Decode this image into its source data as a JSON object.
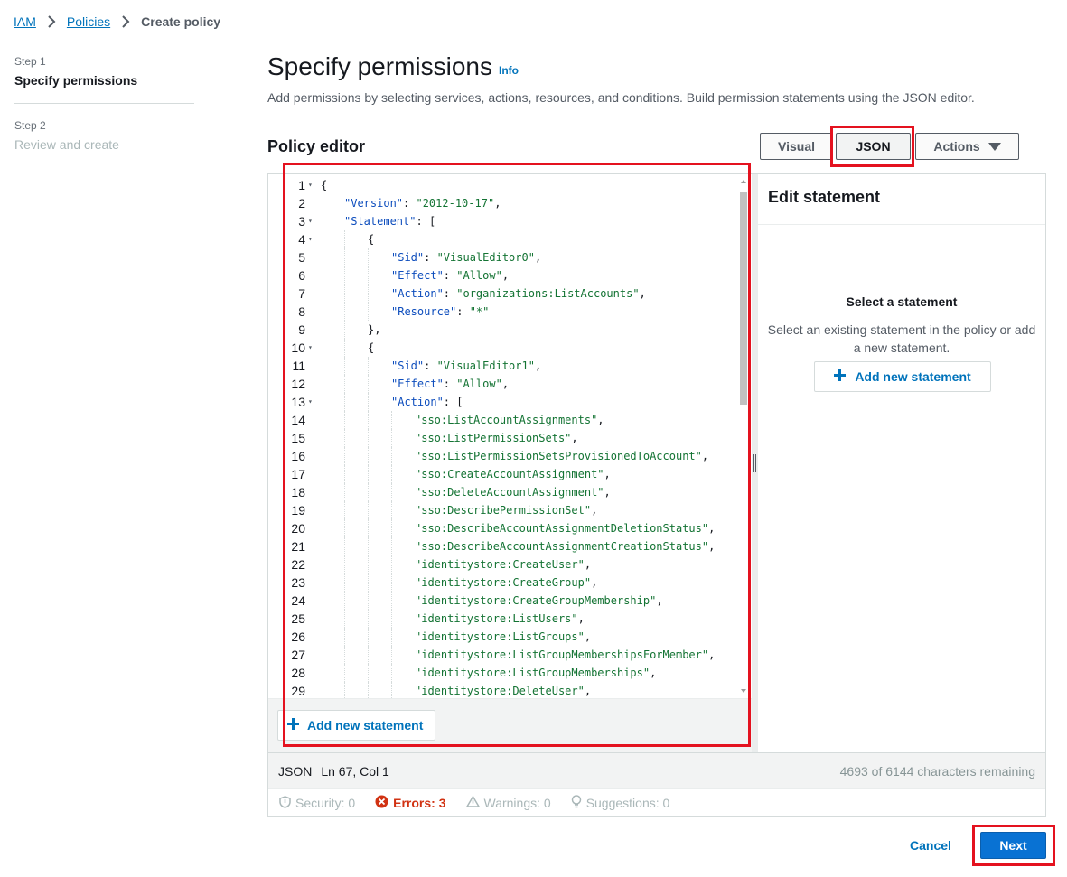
{
  "breadcrumb": {
    "items": [
      "IAM",
      "Policies"
    ],
    "current": "Create policy"
  },
  "steps": [
    {
      "num": "Step 1",
      "title": "Specify permissions"
    },
    {
      "num": "Step 2",
      "title": "Review and create"
    }
  ],
  "header": {
    "title": "Specify permissions",
    "info": "Info",
    "description": "Add permissions by selecting services, actions, resources, and conditions. Build permission statements using the JSON editor."
  },
  "editor": {
    "title": "Policy editor",
    "modes": {
      "visual": "Visual",
      "json": "JSON",
      "actions": "Actions"
    },
    "add_statement": "Add new statement",
    "status": {
      "mode": "JSON",
      "position": "Ln 67, Col 1",
      "remaining": "4693 of 6144 characters remaining"
    },
    "issues": {
      "security": "Security: 0",
      "errors": "Errors: 3",
      "warnings": "Warnings: 0",
      "suggestions": "Suggestions: 0"
    }
  },
  "code": [
    {
      "n": "1",
      "fold": true,
      "indent": 0,
      "text": "{"
    },
    {
      "n": "2",
      "fold": false,
      "indent": 1,
      "key": "\"Version\"",
      "val": "\"2012-10-17\"",
      "tail": ","
    },
    {
      "n": "3",
      "fold": true,
      "indent": 1,
      "key": "\"Statement\"",
      "tail": " ["
    },
    {
      "n": "4",
      "fold": true,
      "indent": 2,
      "text": "{"
    },
    {
      "n": "5",
      "fold": false,
      "indent": 3,
      "key": "\"Sid\"",
      "val": "\"VisualEditor0\"",
      "tail": ","
    },
    {
      "n": "6",
      "fold": false,
      "indent": 3,
      "key": "\"Effect\"",
      "val": "\"Allow\"",
      "tail": ","
    },
    {
      "n": "7",
      "fold": false,
      "indent": 3,
      "key": "\"Action\"",
      "val": "\"organizations:ListAccounts\"",
      "tail": ","
    },
    {
      "n": "8",
      "fold": false,
      "indent": 3,
      "key": "\"Resource\"",
      "val": "\"*\"",
      "tail": ""
    },
    {
      "n": "9",
      "fold": false,
      "indent": 2,
      "text": "},"
    },
    {
      "n": "10",
      "fold": true,
      "indent": 2,
      "text": "{"
    },
    {
      "n": "11",
      "fold": false,
      "indent": 3,
      "key": "\"Sid\"",
      "val": "\"VisualEditor1\"",
      "tail": ","
    },
    {
      "n": "12",
      "fold": false,
      "indent": 3,
      "key": "\"Effect\"",
      "val": "\"Allow\"",
      "tail": ","
    },
    {
      "n": "13",
      "fold": true,
      "indent": 3,
      "key": "\"Action\"",
      "tail": " ["
    },
    {
      "n": "14",
      "fold": false,
      "indent": 4,
      "val": "\"sso:ListAccountAssignments\"",
      "tail": ","
    },
    {
      "n": "15",
      "fold": false,
      "indent": 4,
      "val": "\"sso:ListPermissionSets\"",
      "tail": ","
    },
    {
      "n": "16",
      "fold": false,
      "indent": 4,
      "val": "\"sso:ListPermissionSetsProvisionedToAccount\"",
      "tail": ","
    },
    {
      "n": "17",
      "fold": false,
      "indent": 4,
      "val": "\"sso:CreateAccountAssignment\"",
      "tail": ","
    },
    {
      "n": "18",
      "fold": false,
      "indent": 4,
      "val": "\"sso:DeleteAccountAssignment\"",
      "tail": ","
    },
    {
      "n": "19",
      "fold": false,
      "indent": 4,
      "val": "\"sso:DescribePermissionSet\"",
      "tail": ","
    },
    {
      "n": "20",
      "fold": false,
      "indent": 4,
      "val": "\"sso:DescribeAccountAssignmentDeletionStatus\"",
      "tail": ","
    },
    {
      "n": "21",
      "fold": false,
      "indent": 4,
      "val": "\"sso:DescribeAccountAssignmentCreationStatus\"",
      "tail": ","
    },
    {
      "n": "22",
      "fold": false,
      "indent": 4,
      "val": "\"identitystore:CreateUser\"",
      "tail": ","
    },
    {
      "n": "23",
      "fold": false,
      "indent": 4,
      "val": "\"identitystore:CreateGroup\"",
      "tail": ","
    },
    {
      "n": "24",
      "fold": false,
      "indent": 4,
      "val": "\"identitystore:CreateGroupMembership\"",
      "tail": ","
    },
    {
      "n": "25",
      "fold": false,
      "indent": 4,
      "val": "\"identitystore:ListUsers\"",
      "tail": ","
    },
    {
      "n": "26",
      "fold": false,
      "indent": 4,
      "val": "\"identitystore:ListGroups\"",
      "tail": ","
    },
    {
      "n": "27",
      "fold": false,
      "indent": 4,
      "val": "\"identitystore:ListGroupMembershipsForMember\"",
      "tail": ","
    },
    {
      "n": "28",
      "fold": false,
      "indent": 4,
      "val": "\"identitystore:ListGroupMemberships\"",
      "tail": ","
    },
    {
      "n": "29",
      "fold": false,
      "indent": 4,
      "val": "\"identitystore:DeleteUser\"",
      "tail": ","
    }
  ],
  "statement_panel": {
    "title": "Edit statement",
    "subtitle": "Select a statement",
    "description": "Select an existing statement in the policy or add a new statement.",
    "add_button": "Add new statement"
  },
  "footer": {
    "cancel": "Cancel",
    "next": "Next"
  },
  "colors": {
    "link": "#0073bb",
    "primary": "#0972d3",
    "error": "#d13212",
    "highlight": "#e4121f"
  }
}
